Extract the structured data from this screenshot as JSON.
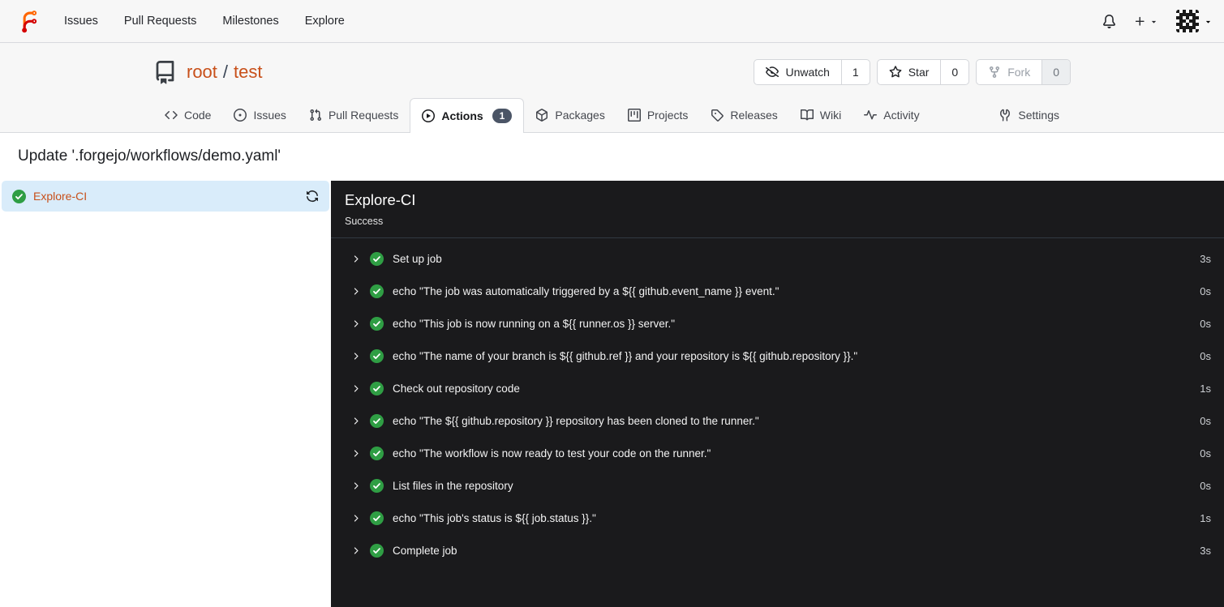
{
  "navbar": {
    "items": [
      {
        "label": "Issues"
      },
      {
        "label": "Pull Requests"
      },
      {
        "label": "Milestones"
      },
      {
        "label": "Explore"
      }
    ],
    "right_icons": [
      {
        "name": "bell-icon"
      },
      {
        "name": "plus-icon"
      },
      {
        "name": "avatar-identicon"
      }
    ]
  },
  "repo_header": {
    "owner": "root",
    "separator": "/",
    "name": "test",
    "actions": [
      {
        "icon": "unwatch-icon",
        "label": "Unwatch",
        "count": "1",
        "disabled": false
      },
      {
        "icon": "star-icon",
        "label": "Star",
        "count": "0",
        "disabled": false
      },
      {
        "icon": "fork-icon",
        "label": "Fork",
        "count": "0",
        "disabled": true
      }
    ]
  },
  "tabs": [
    {
      "label": "Code",
      "icon": "code-icon",
      "active": false
    },
    {
      "label": "Issues",
      "icon": "issue-icon",
      "active": false
    },
    {
      "label": "Pull Requests",
      "icon": "pull-request-icon",
      "active": false
    },
    {
      "label": "Actions",
      "icon": "actions-icon",
      "active": true,
      "badge": "1"
    },
    {
      "label": "Packages",
      "icon": "package-icon",
      "active": false
    },
    {
      "label": "Projects",
      "icon": "project-icon",
      "active": false
    },
    {
      "label": "Releases",
      "icon": "tag-icon",
      "active": false
    },
    {
      "label": "Wiki",
      "icon": "wiki-icon",
      "active": false
    },
    {
      "label": "Activity",
      "icon": "activity-icon",
      "active": false
    },
    {
      "label": "Settings",
      "icon": "settings-icon",
      "active": false,
      "align": "right"
    }
  ],
  "run": {
    "title": "Update '.forgejo/workflows/demo.yaml'",
    "job": {
      "name": "Explore-CI",
      "status_icon": "check-circle-icon",
      "refresh_icon": "refresh-icon"
    },
    "panel": {
      "title": "Explore-CI",
      "status": "Success"
    },
    "steps": [
      {
        "name": "Set up job",
        "duration": "3s"
      },
      {
        "name": "echo \"The job was automatically triggered by a ${{ github.event_name }} event.\"",
        "duration": "0s"
      },
      {
        "name": "echo \"This job is now running on a ${{ runner.os }} server.\"",
        "duration": "0s"
      },
      {
        "name": "echo \"The name of your branch is ${{ github.ref }} and your repository is ${{ github.repository }}.\"",
        "duration": "0s"
      },
      {
        "name": "Check out repository code",
        "duration": "1s"
      },
      {
        "name": "echo \"The ${{ github.repository }} repository has been cloned to the runner.\"",
        "duration": "0s"
      },
      {
        "name": "echo \"The workflow is now ready to test your code on the runner.\"",
        "duration": "0s"
      },
      {
        "name": "List files in the repository",
        "duration": "0s"
      },
      {
        "name": "echo \"This job's status is ${{ job.status }}.\"",
        "duration": "1s"
      },
      {
        "name": "Complete job",
        "duration": "3s"
      }
    ]
  },
  "colors": {
    "accent": "#c8501a",
    "success_green": "#2f9e44",
    "panel_bg": "#1a1a1c",
    "selected_job_bg": "#d9ecfa",
    "badge_bg": "#4b5566",
    "header_bg": "#f7f7f7"
  }
}
